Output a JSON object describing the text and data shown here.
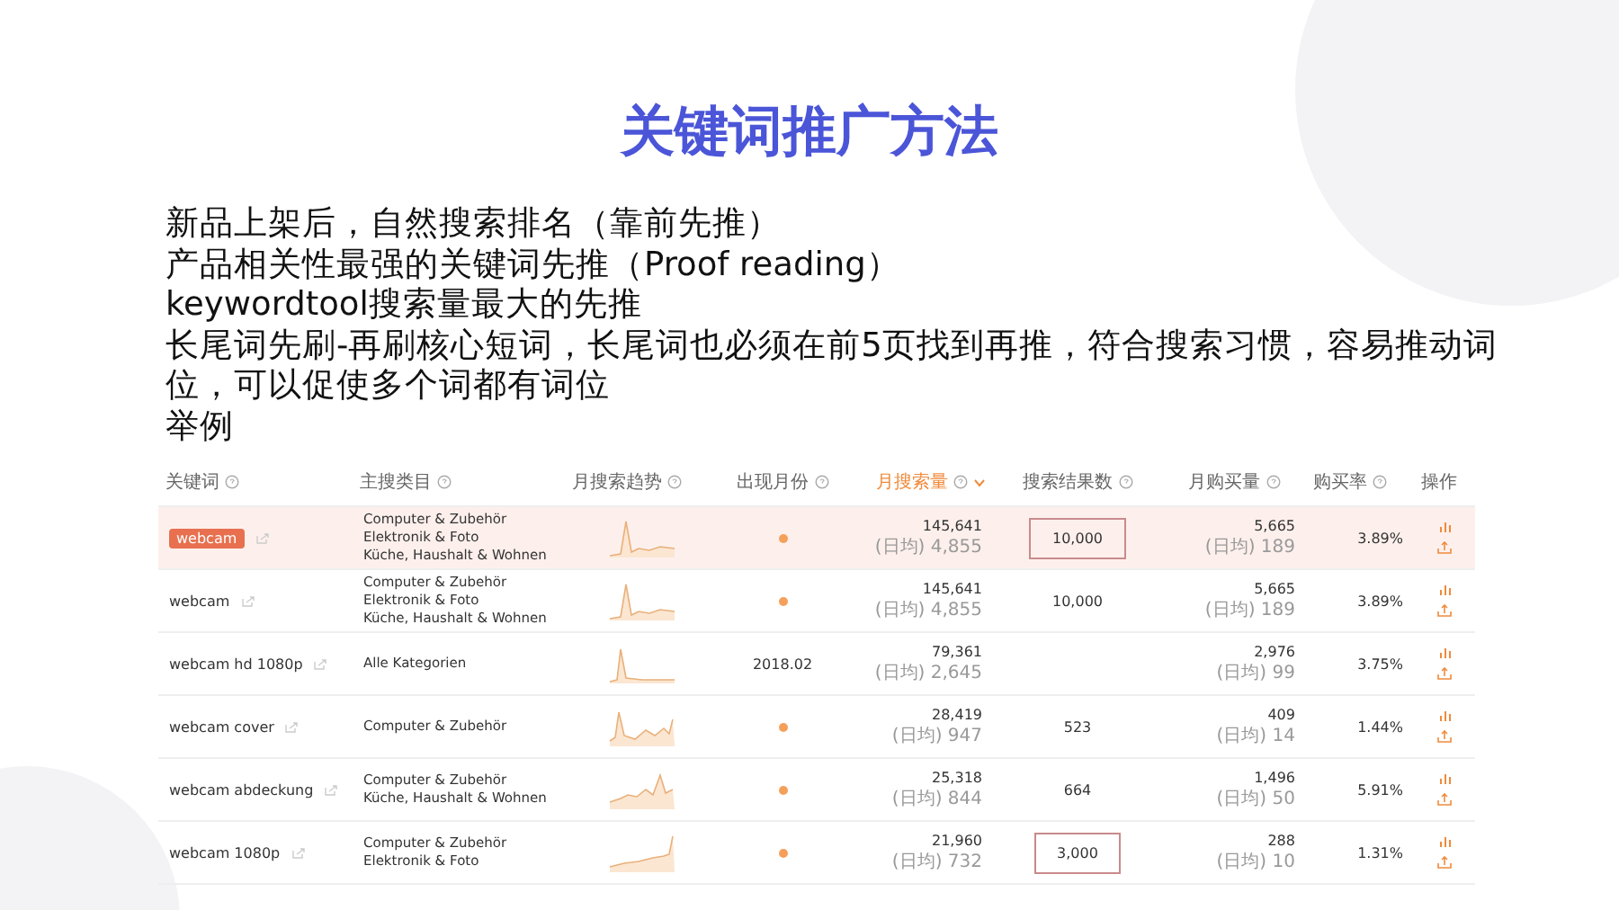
{
  "title": "关键词推广方法",
  "bullets": [
    "新品上架后，自然搜索排名（靠前先推）",
    "产品相关性最强的关键词先推（Proof reading）",
    "keywordtool搜索量最大的先推",
    "长尾词先刷-再刷核心短词，长尾词也必须在前5页找到再推，符合搜索习惯，容易推动词位，可以促使多个词都有词位",
    "举例"
  ],
  "table": {
    "columns": [
      {
        "label": "关键词",
        "help": true,
        "sorted": false
      },
      {
        "label": "主搜类目",
        "help": true,
        "sorted": false
      },
      {
        "label": "月搜索趋势",
        "help": true,
        "sorted": false
      },
      {
        "label": "出现月份",
        "help": true,
        "sorted": false
      },
      {
        "label": "月搜索量",
        "help": true,
        "sorted": true
      },
      {
        "label": "搜索结果数",
        "help": true,
        "sorted": false
      },
      {
        "label": "月购买量",
        "help": true,
        "sorted": false
      },
      {
        "label": "购买率",
        "help": true,
        "sorted": false
      },
      {
        "label": "操作",
        "help": false,
        "sorted": false
      }
    ],
    "rows": [
      {
        "keyword": "webcam",
        "tagged": true,
        "highlighted": true,
        "categories": [
          "Computer & Zubehör",
          "Elektronik & Foto",
          "Küche, Haushalt & Wohnen"
        ],
        "month_mark": true,
        "volume": "145,641",
        "volume_daily": "(日均) 4,855",
        "results": "10,000",
        "results_boxed": true,
        "purchases": "5,665",
        "purchases_daily": "(日均) 189",
        "rate": "3.89%"
      },
      {
        "keyword": "webcam",
        "tagged": false,
        "highlighted": false,
        "categories": [
          "Computer & Zubehör",
          "Elektronik & Foto",
          "Küche, Haushalt & Wohnen"
        ],
        "month_mark": true,
        "volume": "145,641",
        "volume_daily": "(日均) 4,855",
        "results": "10,000",
        "results_boxed": false,
        "purchases": "5,665",
        "purchases_daily": "(日均) 189",
        "rate": "3.89%"
      },
      {
        "keyword": "webcam hd 1080p",
        "tagged": false,
        "highlighted": false,
        "categories": [
          "Alle Kategorien"
        ],
        "month_mark": false,
        "month": "2018.02",
        "volume": "79,361",
        "volume_daily": "(日均) 2,645",
        "results_boxed": false,
        "purchases": "2,976",
        "purchases_daily": "(日均) 99",
        "rate": "3.75%"
      },
      {
        "keyword": "webcam cover",
        "tagged": false,
        "highlighted": false,
        "categories": [
          "Computer & Zubehör"
        ],
        "month_mark": true,
        "volume": "28,419",
        "volume_daily": "(日均) 947",
        "results": "523",
        "results_boxed": false,
        "purchases": "409",
        "purchases_daily": "(日均) 14",
        "rate": "1.44%"
      },
      {
        "keyword": "webcam abdeckung",
        "tagged": false,
        "highlighted": false,
        "categories": [
          "Computer & Zubehör",
          "Küche, Haushalt & Wohnen"
        ],
        "month_mark": true,
        "volume": "25,318",
        "volume_daily": "(日均) 844",
        "results": "664",
        "results_boxed": false,
        "purchases": "1,496",
        "purchases_daily": "(日均) 50",
        "rate": "5.91%"
      },
      {
        "keyword": "webcam 1080p",
        "tagged": false,
        "highlighted": false,
        "categories": [
          "Computer & Zubehör",
          "Elektronik & Foto"
        ],
        "month_mark": true,
        "volume": "21,960",
        "volume_daily": "(日均) 732",
        "results": "3,000",
        "results_boxed": true,
        "purchases": "288",
        "purchases_daily": "(日均) 10",
        "rate": "1.31%"
      }
    ]
  }
}
